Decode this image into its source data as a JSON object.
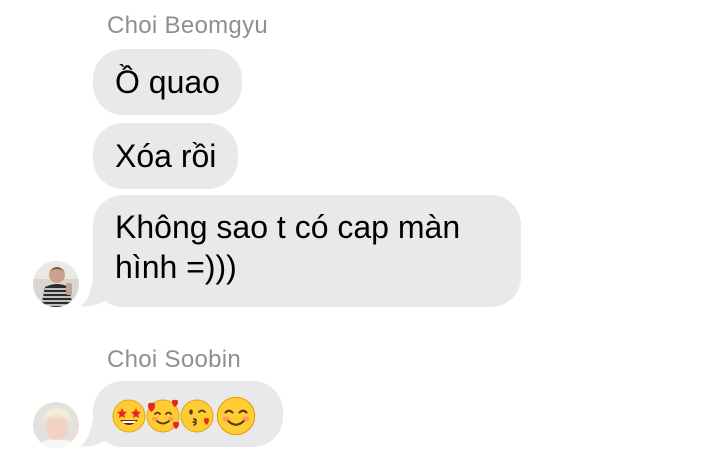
{
  "conversation": {
    "groups": [
      {
        "sender": "Choi Beomgyu",
        "avatar": "beomgyu-avatar",
        "messages": [
          {
            "text": "Ồ quao"
          },
          {
            "text": "Xóa rồi"
          },
          {
            "line1": "Không sao t có cap màn",
            "line2": "hình =)))"
          }
        ]
      },
      {
        "sender": "Choi Soobin",
        "avatar": "soobin-avatar",
        "messages": [
          {
            "emojis": [
              "star-struck-emoji",
              "smiling-face-with-hearts-emoji",
              "face-blowing-kiss-emoji",
              "smiling-face-emoji"
            ]
          }
        ]
      }
    ]
  },
  "colors": {
    "bubble": "#e9e9eb",
    "sender_name": "#8e8e93",
    "text": "#000000"
  }
}
